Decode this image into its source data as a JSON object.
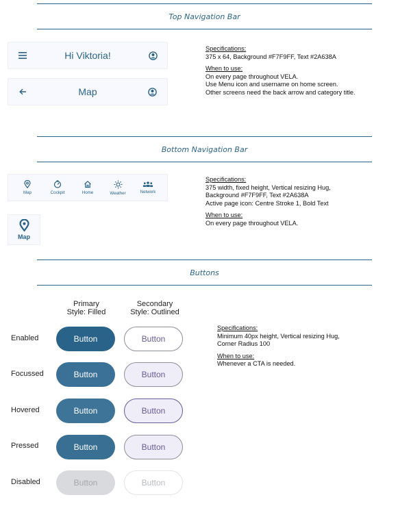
{
  "colors": {
    "primary": "#2A638A",
    "nav_background": "#F7F9FF",
    "secondary_fill_tint": "#efedf8",
    "secondary_text": "#6a5a9a",
    "disabled_fill": "#d8dadd"
  },
  "top_nav_section": {
    "title": "Top Navigation Bar",
    "home_bar": {
      "menu_icon": "hamburger-menu-icon",
      "title": "Hi Viktoria!",
      "profile_icon": "account-circle-icon"
    },
    "category_bar": {
      "back_icon": "arrow-left-icon",
      "title": "Map",
      "profile_icon": "account-circle-icon"
    },
    "spec": {
      "specifications_heading": "Specifications:",
      "specifications_text": "375 x 64, Background #F7F9FF, Text #2A638A",
      "when_heading": "When to use:",
      "when_lines": [
        "On every page throughout VELA.",
        "Use Menu icon and username on home screen.",
        "Other screens need the back arrow and category title."
      ]
    }
  },
  "bottom_nav_section": {
    "title": "Bottom Navigation Bar",
    "items": [
      {
        "label": "Map",
        "icon": "location-pin-icon"
      },
      {
        "label": "Cockpit",
        "icon": "speedometer-icon"
      },
      {
        "label": "Home",
        "icon": "home-icon"
      },
      {
        "label": "Weather",
        "icon": "sun-icon"
      },
      {
        "label": "Network",
        "icon": "people-group-icon"
      }
    ],
    "active_item": {
      "label": "Map",
      "icon": "location-pin-icon"
    },
    "spec": {
      "specifications_heading": "Specifications:",
      "specifications_lines": [
        "375 width, fixed height, Vertical resizing Hug,",
        "Background #F7F9FF, Text #2A638A",
        "Active page icon: Centre Stroke 1, Bold Text"
      ],
      "when_heading": "When to use:",
      "when_lines": [
        "On every page throughout VELA."
      ]
    }
  },
  "buttons_section": {
    "title": "Buttons",
    "primary_header": [
      "Primary",
      "Style: Filled"
    ],
    "secondary_header": [
      "Secondary",
      "Style: Outlined"
    ],
    "button_label": "Button",
    "states": [
      "Enabled",
      "Focussed",
      "Hovered",
      "Pressed",
      "Disabled"
    ],
    "spec": {
      "specifications_heading": "Specifications:",
      "specifications_lines": [
        "Minimum 40px height, Vertical resizing Hug,",
        "Corner Radius 100"
      ],
      "when_heading": "When to use:",
      "when_lines": [
        "Whenever a CTA is needed."
      ]
    }
  }
}
